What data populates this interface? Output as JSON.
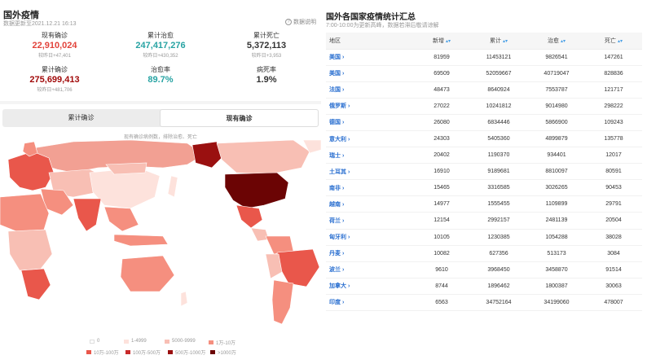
{
  "left": {
    "title": "国外疫情",
    "subtitle": "数据更新至2021.12.21 16:13",
    "explain": "数据说明",
    "stats": [
      {
        "label": "现有确诊",
        "value": "22,910,024",
        "delta": "较昨日+47,401",
        "color": "#e2433b"
      },
      {
        "label": "累计治愈",
        "value": "247,417,276",
        "delta": "较昨日+430,352",
        "color": "#27a3a3"
      },
      {
        "label": "累计死亡",
        "value": "5,372,113",
        "delta": "较昨日+3,953",
        "color": "#333333"
      },
      {
        "label": "累计确诊",
        "value": "275,699,413",
        "delta": "较昨日+481,706",
        "color": "#a10a0a"
      },
      {
        "label": "治愈率",
        "value": "89.7%",
        "delta": "",
        "color": "#27a3a3"
      },
      {
        "label": "病死率",
        "value": "1.9%",
        "delta": "",
        "color": "#333333"
      }
    ],
    "tabs": [
      "累计确诊",
      "现有确诊"
    ],
    "active_tab": 1,
    "map_note": "现有确诊病例数，排除治愈、死亡",
    "legend": [
      {
        "label": "0",
        "color": "#ffffff"
      },
      {
        "label": "1-4999",
        "color": "#fde2dc"
      },
      {
        "label": "5000-9999",
        "color": "#f8bfb4"
      },
      {
        "label": "1万-10万",
        "color": "#f58f7f"
      },
      {
        "label": "10万-100万",
        "color": "#e9574b"
      },
      {
        "label": "100万-500万",
        "color": "#c82a2a"
      },
      {
        "label": "500万-1000万",
        "color": "#9a1010"
      },
      {
        "label": ">1000万",
        "color": "#6b0404"
      }
    ]
  },
  "right": {
    "title": "国外各国家疫情统计汇总",
    "subtitle": "7:00-10:00为更新高峰，数据若滞后敬请谅解",
    "columns": [
      "地区",
      "新增",
      "累计",
      "治愈",
      "死亡"
    ],
    "rows": [
      [
        "美国",
        "81959",
        "11453121",
        "9826541",
        "147261"
      ],
      [
        "美国",
        "69509",
        "52059667",
        "40719047",
        "828836"
      ],
      [
        "法国",
        "48473",
        "8640924",
        "7553787",
        "121717"
      ],
      [
        "俄罗斯",
        "27022",
        "10241812",
        "9014980",
        "298222"
      ],
      [
        "德国",
        "26080",
        "6834446",
        "5866900",
        "109243"
      ],
      [
        "意大利",
        "24303",
        "5405360",
        "4899879",
        "135778"
      ],
      [
        "瑞士",
        "20402",
        "1190370",
        "934401",
        "12017"
      ],
      [
        "土耳其",
        "16910",
        "9189681",
        "8810097",
        "80591"
      ],
      [
        "南非",
        "15465",
        "3316585",
        "3026265",
        "90453"
      ],
      [
        "越南",
        "14977",
        "1555455",
        "1109899",
        "29791"
      ],
      [
        "荷兰",
        "12154",
        "2992157",
        "2481139",
        "20504"
      ],
      [
        "匈牙利",
        "10105",
        "1230385",
        "1054288",
        "38028"
      ],
      [
        "丹麦",
        "10082",
        "627356",
        "513173",
        "3084"
      ],
      [
        "波兰",
        "9610",
        "3968450",
        "3458870",
        "91514"
      ],
      [
        "加拿大",
        "8744",
        "1896462",
        "1800387",
        "30063"
      ],
      [
        "印度",
        "6563",
        "34752164",
        "34199060",
        "478007"
      ]
    ]
  }
}
